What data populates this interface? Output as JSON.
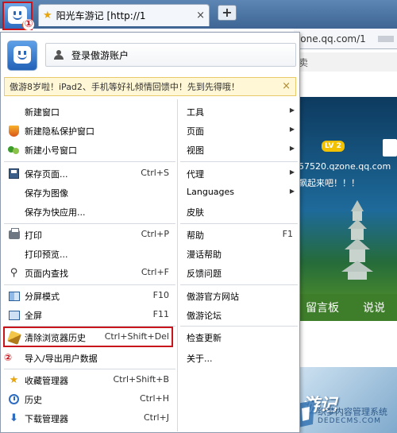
{
  "tabbar": {
    "tab_title": "阳光车游记 [http://1",
    "new_tab_label": "+",
    "tab_close": "×",
    "marker1": "①"
  },
  "page_bg": {
    "address_partial": "zone.qq.com/1",
    "strip_text": "卖",
    "level_badge": "LV 2",
    "url_text": "57520.qzone.qq.com",
    "slogan": "飙起来吧！！！",
    "nav_items": [
      "留言板",
      "说说"
    ],
    "banner_title": "游记",
    "watermark_line1": "织梦内容管理系统",
    "watermark_line2": "DEDECMS.COM"
  },
  "menu": {
    "login_label": "登录傲游账户",
    "promo_text": "傲游8岁啦！iPad2、手机等好礼倾情回馈中！先到先得哦！",
    "promo_close": "×",
    "marker2": "②",
    "left_items": [
      {
        "label": "新建窗口",
        "shortcut": ""
      },
      {
        "label": "新建隐私保护窗口",
        "shortcut": ""
      },
      {
        "label": "新建小号窗口",
        "shortcut": ""
      },
      {
        "label": "保存页面...",
        "shortcut": "Ctrl+S"
      },
      {
        "label": "保存为图像",
        "shortcut": ""
      },
      {
        "label": "保存为快应用...",
        "shortcut": ""
      },
      {
        "label": "打印",
        "shortcut": "Ctrl+P"
      },
      {
        "label": "打印预览...",
        "shortcut": ""
      },
      {
        "label": "页面内查找",
        "shortcut": "Ctrl+F"
      },
      {
        "label": "分屏模式",
        "shortcut": "F10"
      },
      {
        "label": "全屏",
        "shortcut": "F11"
      },
      {
        "label": "清除浏览器历史",
        "shortcut": "Ctrl+Shift+Del"
      },
      {
        "label": "导入/导出用户数据",
        "shortcut": ""
      },
      {
        "label": "收藏管理器",
        "shortcut": "Ctrl+Shift+B"
      },
      {
        "label": "历史",
        "shortcut": "Ctrl+H"
      },
      {
        "label": "下载管理器",
        "shortcut": "Ctrl+J"
      }
    ],
    "right_items": [
      {
        "label": "工具",
        "shortcut": ""
      },
      {
        "label": "页面",
        "shortcut": ""
      },
      {
        "label": "视图",
        "shortcut": ""
      },
      {
        "label": "代理",
        "shortcut": ""
      },
      {
        "label": "Languages",
        "shortcut": ""
      },
      {
        "label": "皮肤",
        "shortcut": ""
      },
      {
        "label": "帮助",
        "shortcut": "F1"
      },
      {
        "label": "漫话帮助",
        "shortcut": ""
      },
      {
        "label": "反馈问题",
        "shortcut": ""
      },
      {
        "label": "傲游官方网站",
        "shortcut": ""
      },
      {
        "label": "傲游论坛",
        "shortcut": ""
      },
      {
        "label": "检查更新",
        "shortcut": ""
      },
      {
        "label": "关于...",
        "shortcut": ""
      }
    ]
  },
  "colors": {
    "highlight_red": "#c8141b",
    "tabbar_blue": "#4a73a3"
  }
}
